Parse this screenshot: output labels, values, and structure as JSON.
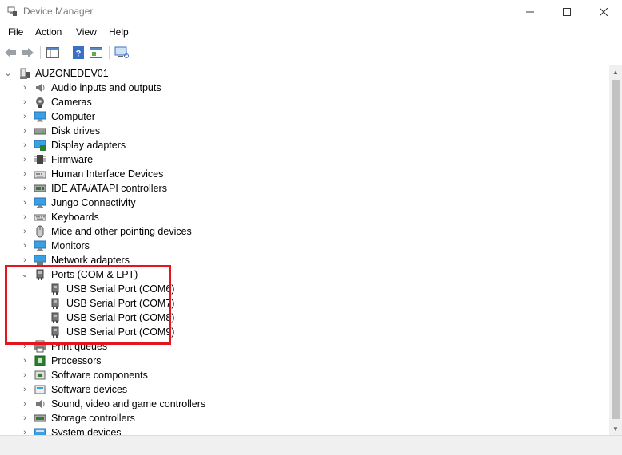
{
  "window": {
    "title": "Device Manager"
  },
  "menu": {
    "file": "File",
    "action": "Action",
    "view": "View",
    "help": "Help"
  },
  "tree": {
    "root": "AUZONEDEV01",
    "categories": [
      {
        "label": "Audio inputs and outputs",
        "icon": "speaker-icon"
      },
      {
        "label": "Cameras",
        "icon": "camera-icon"
      },
      {
        "label": "Computer",
        "icon": "computer-icon"
      },
      {
        "label": "Disk drives",
        "icon": "disk-drive-icon"
      },
      {
        "label": "Display adapters",
        "icon": "display-adapter-icon"
      },
      {
        "label": "Firmware",
        "icon": "firmware-chip-icon"
      },
      {
        "label": "Human Interface Devices",
        "icon": "hid-keyboard-icon"
      },
      {
        "label": "IDE ATA/ATAPI controllers",
        "icon": "ide-controller-icon"
      },
      {
        "label": "Jungo Connectivity",
        "icon": "monitor-icon"
      },
      {
        "label": "Keyboards",
        "icon": "keyboard-icon"
      },
      {
        "label": "Mice and other pointing devices",
        "icon": "mouse-icon"
      },
      {
        "label": "Monitors",
        "icon": "monitor-icon"
      },
      {
        "label": "Network adapters",
        "icon": "network-adapter-icon"
      }
    ],
    "ports": {
      "label": "Ports (COM & LPT)",
      "children": [
        "USB Serial Port (COM6)",
        "USB Serial Port (COM7)",
        "USB Serial Port (COM8)",
        "USB Serial Port (COM9)"
      ]
    },
    "categories_after": [
      {
        "label": "Print queues",
        "icon": "printer-icon"
      },
      {
        "label": "Processors",
        "icon": "processor-icon"
      },
      {
        "label": "Software components",
        "icon": "software-component-icon"
      },
      {
        "label": "Software devices",
        "icon": "software-device-icon"
      },
      {
        "label": "Sound, video and game controllers",
        "icon": "sound-icon"
      },
      {
        "label": "Storage controllers",
        "icon": "storage-controller-icon"
      },
      {
        "label": "System devices",
        "icon": "system-device-icon"
      }
    ]
  },
  "colors": {
    "highlight_border": "#e2161c",
    "icon_blue": "#2b8ad6"
  }
}
